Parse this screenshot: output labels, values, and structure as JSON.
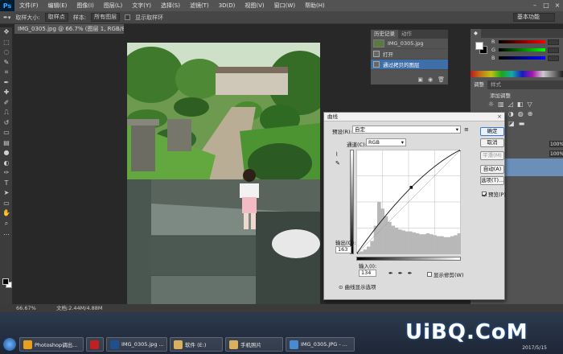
{
  "menubar": {
    "logo": "Ps",
    "items": [
      "文件(F)",
      "编辑(E)",
      "图像(I)",
      "图层(L)",
      "文字(Y)",
      "选择(S)",
      "滤镜(T)",
      "3D(D)",
      "视图(V)",
      "窗口(W)",
      "帮助(H)"
    ]
  },
  "options": {
    "sample_size_label": "取样大小:",
    "sample_size_value": "取样点",
    "sample_label": "样本:",
    "sample_value": "所有图层",
    "show_ring": "显示取样环",
    "workspace": "基本功能"
  },
  "doc_tab": {
    "label": "IMG_0305.jpg @ 66.7% (图层 1, RGB/8#) *",
    "close": "×"
  },
  "history": {
    "tabs": [
      "历史记录",
      "动作"
    ],
    "snapshot": "IMG_0305.jpg",
    "items": [
      "打开",
      "通过拷贝的图层"
    ]
  },
  "right_panel": {
    "color_channels": [
      "R",
      "G",
      "B"
    ],
    "adjust_tabs": [
      "调整",
      "样式"
    ],
    "adjust_title": "添加调整",
    "layer_fields": [
      "100%",
      "100%"
    ]
  },
  "curves": {
    "title": "曲线",
    "close": "×",
    "preset_label": "预设(R):",
    "preset_value": "自定",
    "channel_label": "通道(C):",
    "channel_value": "RGB",
    "output_label": "输出(O):",
    "output_value": "163",
    "input_label": "输入(I):",
    "input_value": "134",
    "show_clipping": "显示修剪(W)",
    "curve_display_options": "曲线显示选项",
    "buttons": {
      "ok": "确定",
      "cancel": "取消",
      "smooth": "平滑(M)",
      "auto": "自动(A)",
      "options": "选项(T)...",
      "preview": "预览(P)"
    },
    "curve_points": [
      [
        0,
        0
      ],
      [
        134,
        163
      ],
      [
        255,
        255
      ]
    ],
    "histogram": [
      2,
      3,
      5,
      8,
      14,
      30,
      55,
      48,
      40,
      34,
      30,
      28,
      26,
      25,
      24,
      24,
      23,
      22,
      21,
      21,
      22,
      21,
      20,
      19,
      19,
      18,
      18,
      19,
      20,
      22
    ]
  },
  "status": {
    "zoom": "66.67%",
    "doc": "文档:2.44M/4.88M"
  },
  "taskbar": {
    "buttons": [
      {
        "label": "Photoshop调出...",
        "color": "#e6a020"
      },
      {
        "label": "",
        "color": "#c02020"
      },
      {
        "label": "IMG_0305.jpg ...",
        "color": "#1f4f8f"
      },
      {
        "label": "软件 (E:)",
        "color": "#d8b060"
      },
      {
        "label": "手机照片",
        "color": "#d8b060"
      },
      {
        "label": "IMG_0305.JPG - ...",
        "color": "#4a8ad0"
      }
    ],
    "date": "2017/5/15"
  },
  "watermark": "UiBQ.CoM"
}
